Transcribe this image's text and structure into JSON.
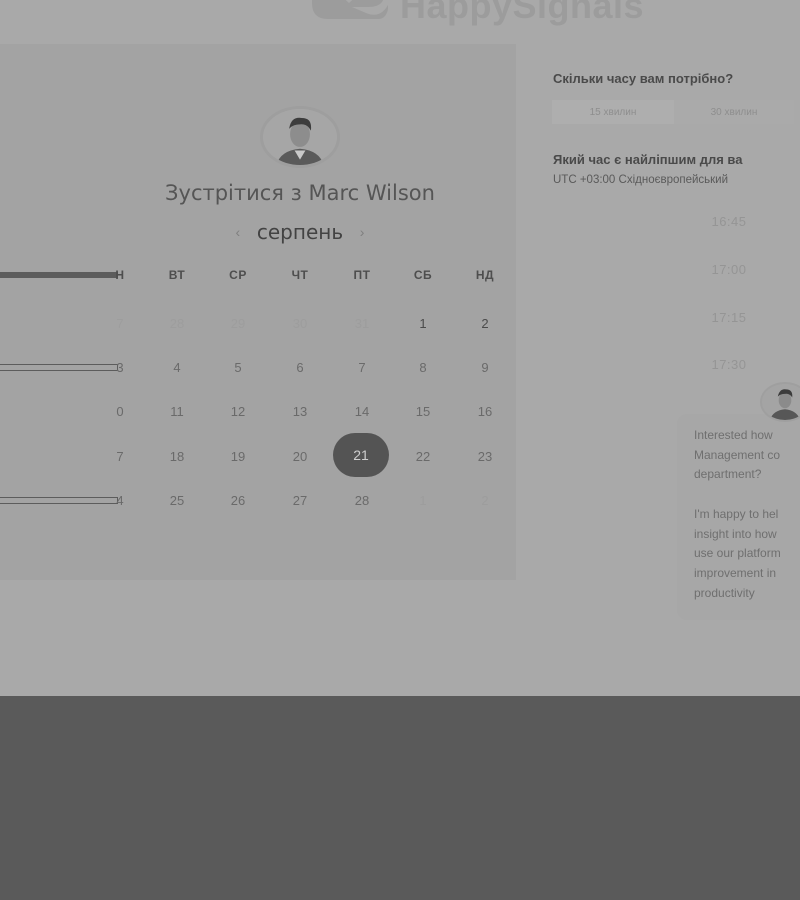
{
  "brand": {
    "name": "HappySignals",
    "logo_color": "#9c9c9c"
  },
  "calendar": {
    "title_prefix": "Зустрітися з",
    "host_name": "Marc Wilson",
    "month": "серпень",
    "prev_icon": "chevron-left-icon",
    "next_icon": "chevron-right-icon",
    "weekday_headers": [
      "Н",
      "ВТ",
      "СР",
      "ЧТ",
      "ПТ",
      "СБ",
      "НД"
    ],
    "weeks": [
      [
        "7",
        "28",
        "29",
        "30",
        "31",
        "1",
        "2"
      ],
      [
        "3",
        "4",
        "5",
        "6",
        "7",
        "8",
        "9"
      ],
      [
        "0",
        "11",
        "12",
        "13",
        "14",
        "15",
        "16"
      ],
      [
        "7",
        "18",
        "19",
        "20",
        "21",
        "22",
        "23"
      ],
      [
        "4",
        "25",
        "26",
        "27",
        "28",
        "1",
        "2"
      ]
    ],
    "selected_day": "21",
    "selected_color": "#545454"
  },
  "scheduler": {
    "duration_question": "Скільки часу вам потрібно?",
    "durations": [
      "15 хвилин",
      "30 хвилин"
    ],
    "time_question": "Який час є найліпшим для ва",
    "timezone": "UTC +03:00 Східноєвропейський",
    "slots": [
      "16:45",
      "17:00",
      "17:15",
      "17:30"
    ]
  },
  "chat": {
    "lines": [
      "Interested how",
      "Management co",
      "department?",
      "I'm happy to hel",
      "insight into how",
      "use our platform",
      "improvement in",
      "productivity"
    ]
  }
}
